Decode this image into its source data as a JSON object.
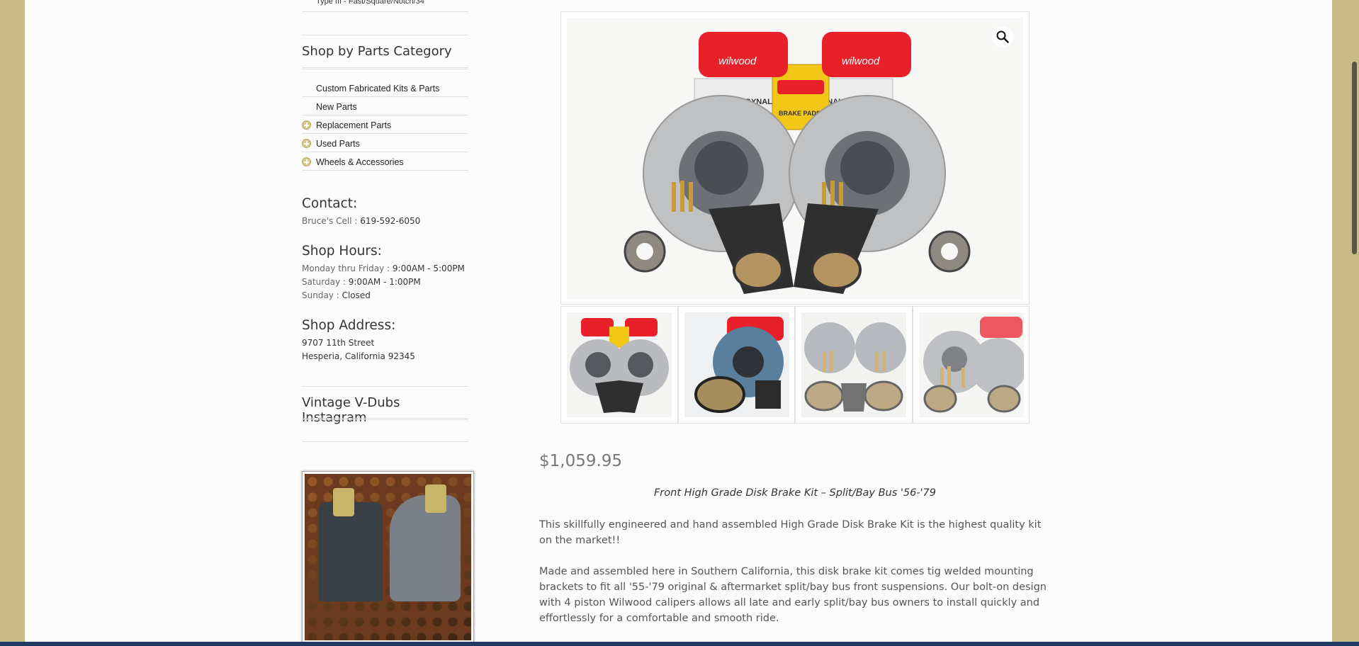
{
  "sidebar": {
    "cut_off_item": "Type III - Fast/Square/Notch/34",
    "category_widget_title": "Shop by Parts Category",
    "categories": [
      {
        "label": "Custom Fabricated Kits & Parts",
        "expandable": false
      },
      {
        "label": "New Parts",
        "expandable": false
      },
      {
        "label": "Replacement Parts",
        "expandable": true
      },
      {
        "label": "Used Parts",
        "expandable": true
      },
      {
        "label": "Wheels & Accessories",
        "expandable": true
      }
    ],
    "contact": {
      "title": "Contact:",
      "cell_label": "Bruce's Cell : ",
      "cell_value": "619-592-6050"
    },
    "hours": {
      "title": "Shop Hours:",
      "rows": [
        {
          "label": "Monday thru Friday : ",
          "value": "9:00AM - 5:00PM"
        },
        {
          "label": "Saturday : ",
          "value": "9:00AM - 1:00PM"
        },
        {
          "label": "Sunday : ",
          "value": "Closed"
        }
      ]
    },
    "address": {
      "title": "Shop Address:",
      "line1": "9707 11th Street",
      "line2": "Hesperia, California 92345"
    },
    "instagram_title": "Vintage V-Dubs Instagram"
  },
  "product": {
    "price": "$1,059.95",
    "subtitle": "Front High Grade Disk Brake Kit – Split/Bay Bus '56-'79",
    "paragraph1": "This skillfully engineered and hand assembled High Grade Disk Brake Kit is the highest quality kit on the market!!",
    "paragraph2": "Made and assembled here in Southern California, this disk brake kit comes tig welded mounting brackets to fit all '55-'79 original & aftermarket split/bay bus front suspensions. Our bolt-on design with 4 piston Wilwood calipers allows all late and early split/bay bus owners to install quickly and effortlessly for a comfortable and smooth ride.",
    "caliper_brand": "wilwood",
    "box_label_left": "DYNALITE",
    "box_label_right": "DYNALITE",
    "box_center_label": "BRAKE PADS",
    "zoom_icon": "magnifier-icon"
  },
  "colors": {
    "background": "#c9bb86",
    "accent_blue": "#1f3a63",
    "caliper_red": "#e8202a"
  }
}
